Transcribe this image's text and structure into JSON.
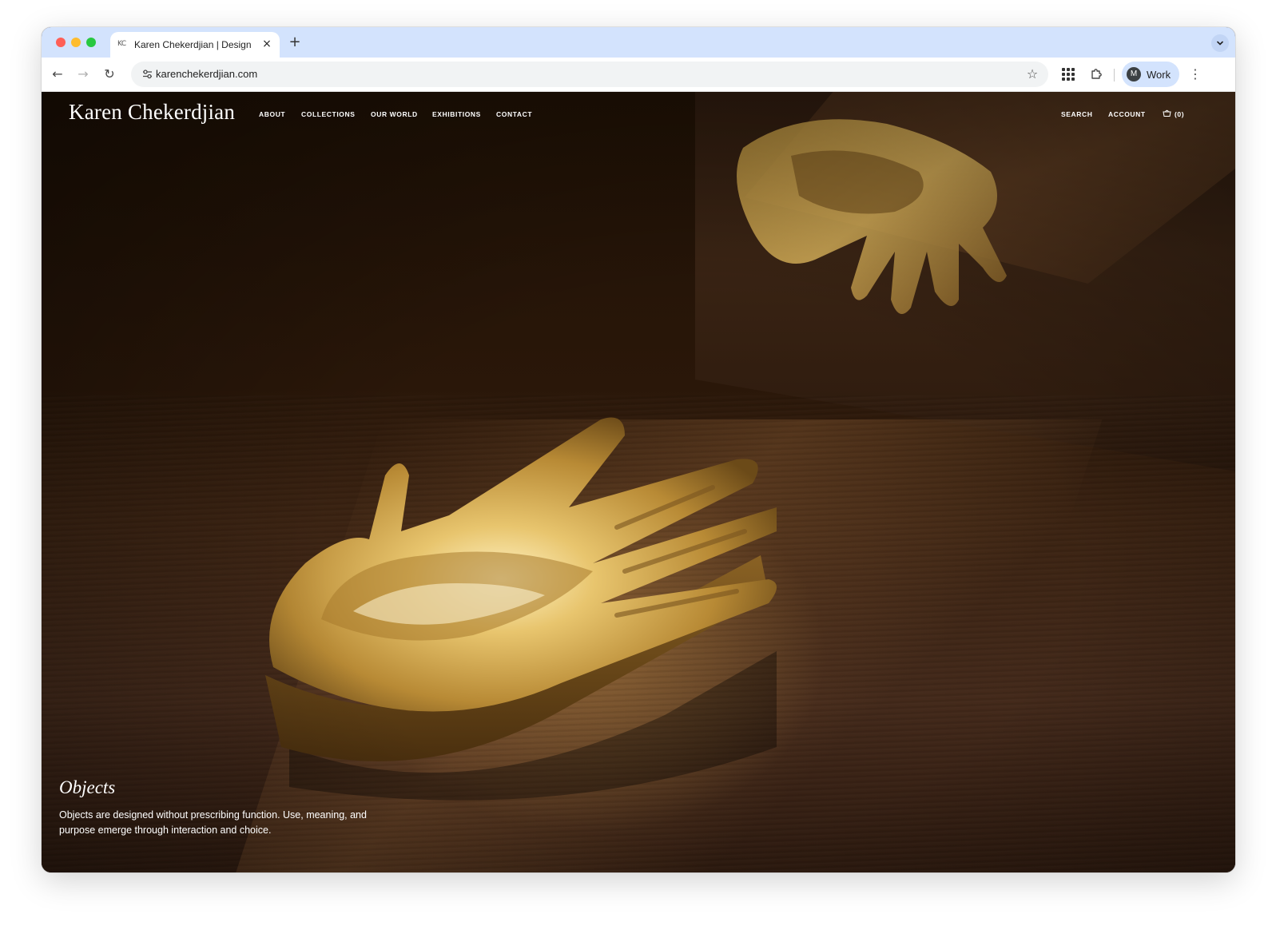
{
  "browser": {
    "tab": {
      "favicon": "KC",
      "title": "Karen Chekerdjian | Design | S",
      "close_icon": "×"
    },
    "new_tab_icon": "+",
    "tab_search_icon": "chevron-down",
    "nav": {
      "back_icon": "←",
      "forward_icon": "→",
      "reload_icon": "↻"
    },
    "site_info_icon": "tune",
    "url": "karenchekerdjian.com",
    "bookmark_icon": "☆",
    "extensions_icon": "puzzle",
    "profile": {
      "initial": "M",
      "name": "Work"
    },
    "menu_icon": "⋮"
  },
  "site": {
    "logo": "Karen Chekerdjian",
    "nav": [
      {
        "label": "ABOUT"
      },
      {
        "label": "COLLECTIONS"
      },
      {
        "label": "OUR WORLD"
      },
      {
        "label": "EXHIBITIONS"
      },
      {
        "label": "CONTACT"
      }
    ],
    "utility": {
      "search": "SEARCH",
      "account": "ACCOUNT",
      "cart_count": "(0)"
    }
  },
  "hero": {
    "title": "Objects",
    "description": "Objects are designed without prescribing function. Use, meaning, and purpose emerge through interaction and choice."
  },
  "colors": {
    "tabstrip": "#d3e3fd",
    "hero_text": "#ffffff",
    "brass": "#c9a24a"
  }
}
